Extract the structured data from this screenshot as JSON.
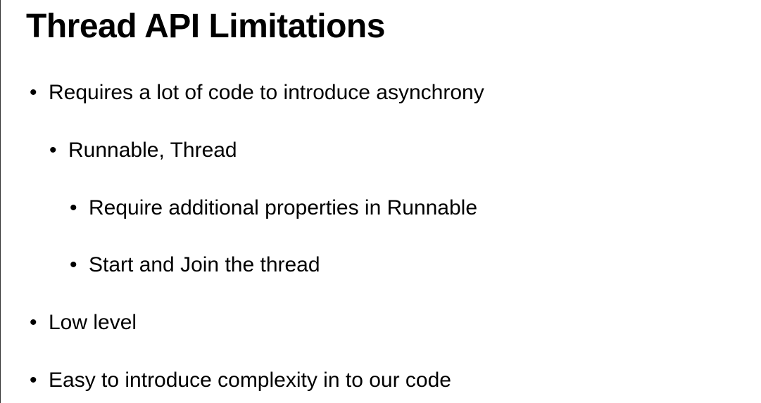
{
  "slide": {
    "title": "Thread API Limitations",
    "bullet_glyph": "•",
    "bullets": [
      {
        "level": 1,
        "text": "Requires a lot of code to introduce asynchrony"
      },
      {
        "level": 2,
        "text": "Runnable, Thread"
      },
      {
        "level": 3,
        "text": "Require additional properties in Runnable"
      },
      {
        "level": 3,
        "text": "Start and Join the thread"
      },
      {
        "level": 1,
        "text": "Low level"
      },
      {
        "level": 1,
        "text": "Easy to introduce complexity in to our code"
      }
    ]
  }
}
